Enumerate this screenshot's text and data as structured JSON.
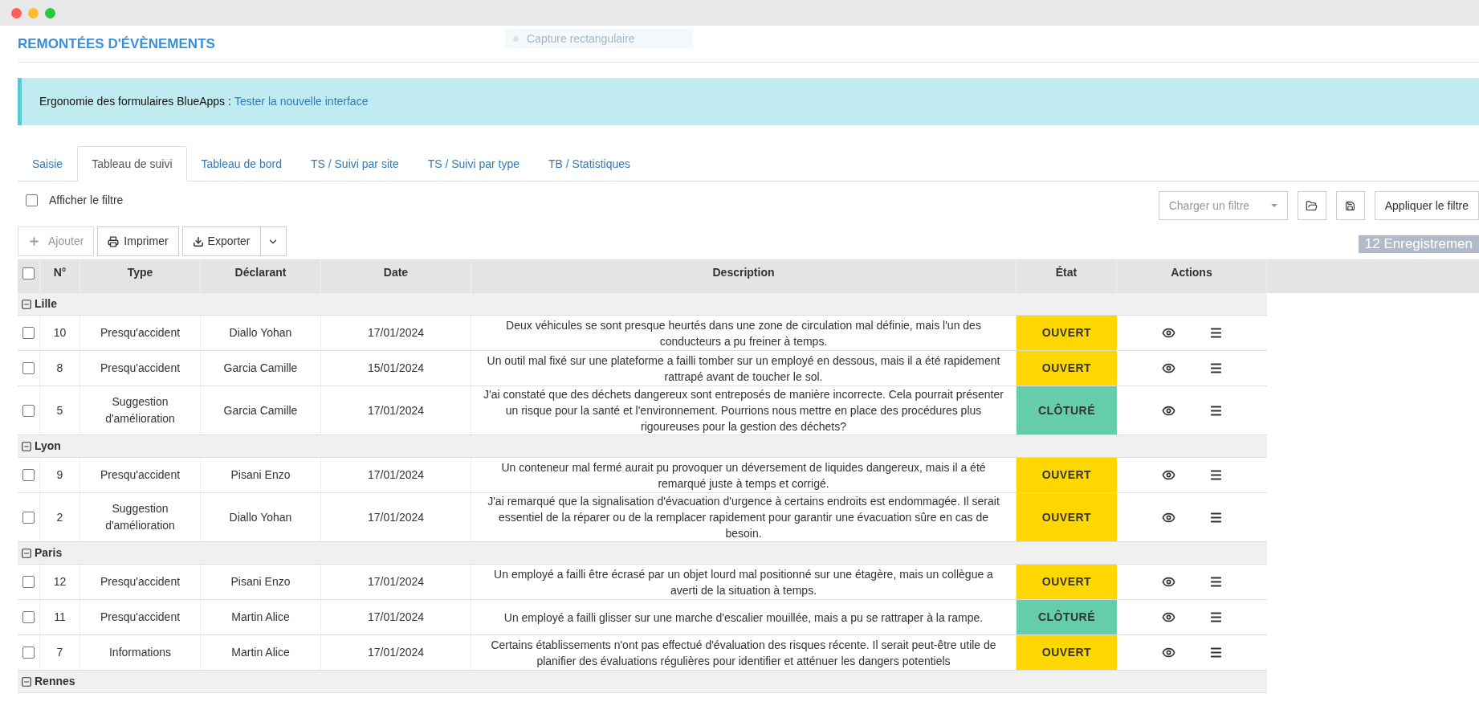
{
  "header": {
    "title": "REMONTÉES D'ÉVÈNEMENTS",
    "overlay_hint": "Capture rectangulaire"
  },
  "banner": {
    "text": "Ergonomie des formulaires BlueApps :",
    "link": "Tester la nouvelle interface"
  },
  "tabs": [
    {
      "label": "Saisie",
      "selected": false
    },
    {
      "label": "Tableau de suivi",
      "selected": true
    },
    {
      "label": "Tableau de bord",
      "selected": false
    },
    {
      "label": "TS / Suivi par site",
      "selected": false
    },
    {
      "label": "TS / Suivi par type",
      "selected": false
    },
    {
      "label": "TB / Statistiques",
      "selected": false
    }
  ],
  "filter_toggle": {
    "label": "Afficher le filtre",
    "checked": false
  },
  "filter_controls": {
    "load_placeholder": "Charger un filtre",
    "apply": "Appliquer le filtre"
  },
  "toolbar": {
    "add": {
      "label": "Ajouter",
      "disabled": true
    },
    "print": "Imprimer",
    "export": "Exporter"
  },
  "record_count": "12 Enregistremen",
  "table": {
    "select_all_checked": false,
    "columns": [
      "N°",
      "Type",
      "Déclarant",
      "Date",
      "Description",
      "État",
      "Actions"
    ],
    "groups": [
      {
        "name": "Lille",
        "expanded": true,
        "rows": [
          {
            "checked": false,
            "number": "10",
            "type": "Presqu'accident",
            "declarant": "Diallo Yohan",
            "date": "17/01/2024",
            "description": "Deux véhicules se sont presque heurtés dans une zone de circulation mal définie, mais l'un des conducteurs a pu freiner à temps.",
            "status": {
              "label": "OUVERT",
              "color": "#ffd700"
            }
          },
          {
            "checked": false,
            "number": "8",
            "type": "Presqu'accident",
            "declarant": "Garcia Camille",
            "date": "15/01/2024",
            "description": "Un outil mal fixé sur une plateforme a failli tomber sur un employé en dessous, mais il a été rapidement rattrapé avant de toucher le sol.",
            "status": {
              "label": "OUVERT",
              "color": "#ffd700"
            }
          },
          {
            "checked": false,
            "number": "5",
            "type": "Suggestion d'amélioration",
            "declarant": "Garcia Camille",
            "date": "17/01/2024",
            "description": "J'ai constaté que des déchets dangereux sont entreposés de manière incorrecte. Cela pourrait présenter un risque pour la santé et l'environnement. Pourrions nous mettre en place des procédures plus rigoureuses pour la gestion des déchets?",
            "status": {
              "label": "CLÔTURÉ",
              "color": "#66cdaa"
            }
          }
        ]
      },
      {
        "name": "Lyon",
        "expanded": true,
        "rows": [
          {
            "checked": false,
            "number": "9",
            "type": "Presqu'accident",
            "declarant": "Pisani Enzo",
            "date": "17/01/2024",
            "description": "Un conteneur mal fermé aurait pu provoquer un déversement de liquides dangereux, mais il a été remarqué juste à temps et corrigé.",
            "status": {
              "label": "OUVERT",
              "color": "#ffd700"
            }
          },
          {
            "checked": false,
            "number": "2",
            "type": "Suggestion d'amélioration",
            "declarant": "Diallo Yohan",
            "date": "17/01/2024",
            "description": "J'ai remarqué que la signalisation d'évacuation d'urgence à certains endroits est endommagée. Il serait essentiel de la réparer ou de la remplacer rapidement pour garantir une évacuation sûre en cas de besoin.",
            "status": {
              "label": "OUVERT",
              "color": "#ffd700"
            }
          }
        ]
      },
      {
        "name": "Paris",
        "expanded": true,
        "rows": [
          {
            "checked": false,
            "number": "12",
            "type": "Presqu'accident",
            "declarant": "Pisani Enzo",
            "date": "17/01/2024",
            "description": "Un employé a failli être écrasé par un objet lourd mal positionné sur une étagère, mais un collègue a averti de la situation à temps.",
            "status": {
              "label": "OUVERT",
              "color": "#ffd700"
            }
          },
          {
            "checked": false,
            "number": "11",
            "type": "Presqu'accident",
            "declarant": "Martin Alice",
            "date": "17/01/2024",
            "description": "Un employé a failli glisser sur une marche d'escalier mouillée, mais a pu se rattraper à la rampe.",
            "status": {
              "label": "CLÔTURÉ",
              "color": "#66cdaa"
            }
          },
          {
            "checked": false,
            "number": "7",
            "type": "Informations",
            "declarant": "Martin Alice",
            "date": "17/01/2024",
            "description": "Certains établissements n'ont pas effectué d'évaluation des risques récente. Il serait peut-être utile de planifier des évaluations régulières pour identifier et atténuer les dangers potentiels",
            "status": {
              "label": "OUVERT",
              "color": "#ffd700"
            }
          }
        ]
      },
      {
        "name": "Rennes",
        "expanded": true
      }
    ]
  }
}
